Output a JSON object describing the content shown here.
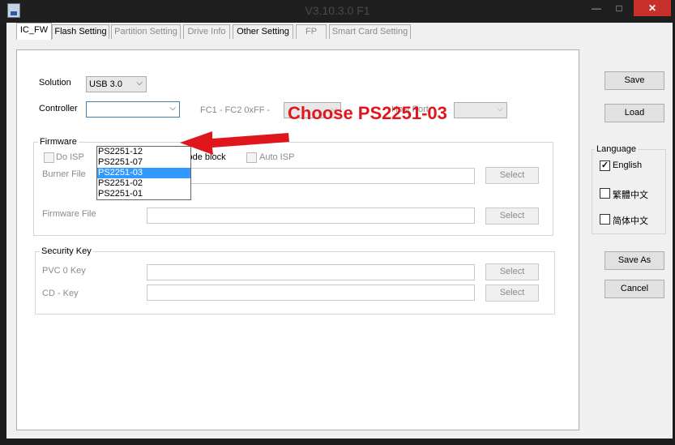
{
  "window": {
    "title": "V3.10.3.0 F1",
    "minimize": "—",
    "maximize": "□",
    "close": "✕"
  },
  "tabs": [
    {
      "label": "IC_FW",
      "active": true
    },
    {
      "label": "Flash Setting"
    },
    {
      "label": "Partition Setting",
      "disabled": true
    },
    {
      "label": "Drive Info",
      "disabled": true
    },
    {
      "label": "Other Setting"
    },
    {
      "label": "FP",
      "disabled": true
    },
    {
      "label": "Smart Card Setting",
      "disabled": true
    }
  ],
  "form": {
    "solution_label": "Solution",
    "solution_value": "USB 3.0",
    "controller_label": "Controller",
    "controller_value": "",
    "fc_label": "FC1 - FC2   0xFF -",
    "host_port_label": "Host Port",
    "controller_options": [
      "PS2251-12",
      "PS2251-07",
      "PS2251-03",
      "PS2251-02",
      "PS2251-01"
    ],
    "controller_highlighted": "PS2251-03"
  },
  "firmware": {
    "title": "Firmware",
    "do_isp": "Do ISP",
    "code_block": "code block",
    "auto_isp": "Auto ISP",
    "burner_label": "Burner File",
    "firmware_label": "Firmware File",
    "select": "Select"
  },
  "security": {
    "title": "Security Key",
    "pvc_label": "PVC 0 Key",
    "cd_label": "CD - Key",
    "select": "Select"
  },
  "buttons": {
    "save": "Save",
    "load": "Load",
    "save_as": "Save As",
    "cancel": "Cancel"
  },
  "language": {
    "title": "Language",
    "options": [
      {
        "label": "English",
        "checked": true
      },
      {
        "label": "繁體中文",
        "checked": false
      },
      {
        "label": "简体中文",
        "checked": false
      }
    ]
  },
  "annotation": {
    "text": "Choose PS2251-03",
    "color": "#e0161d"
  }
}
